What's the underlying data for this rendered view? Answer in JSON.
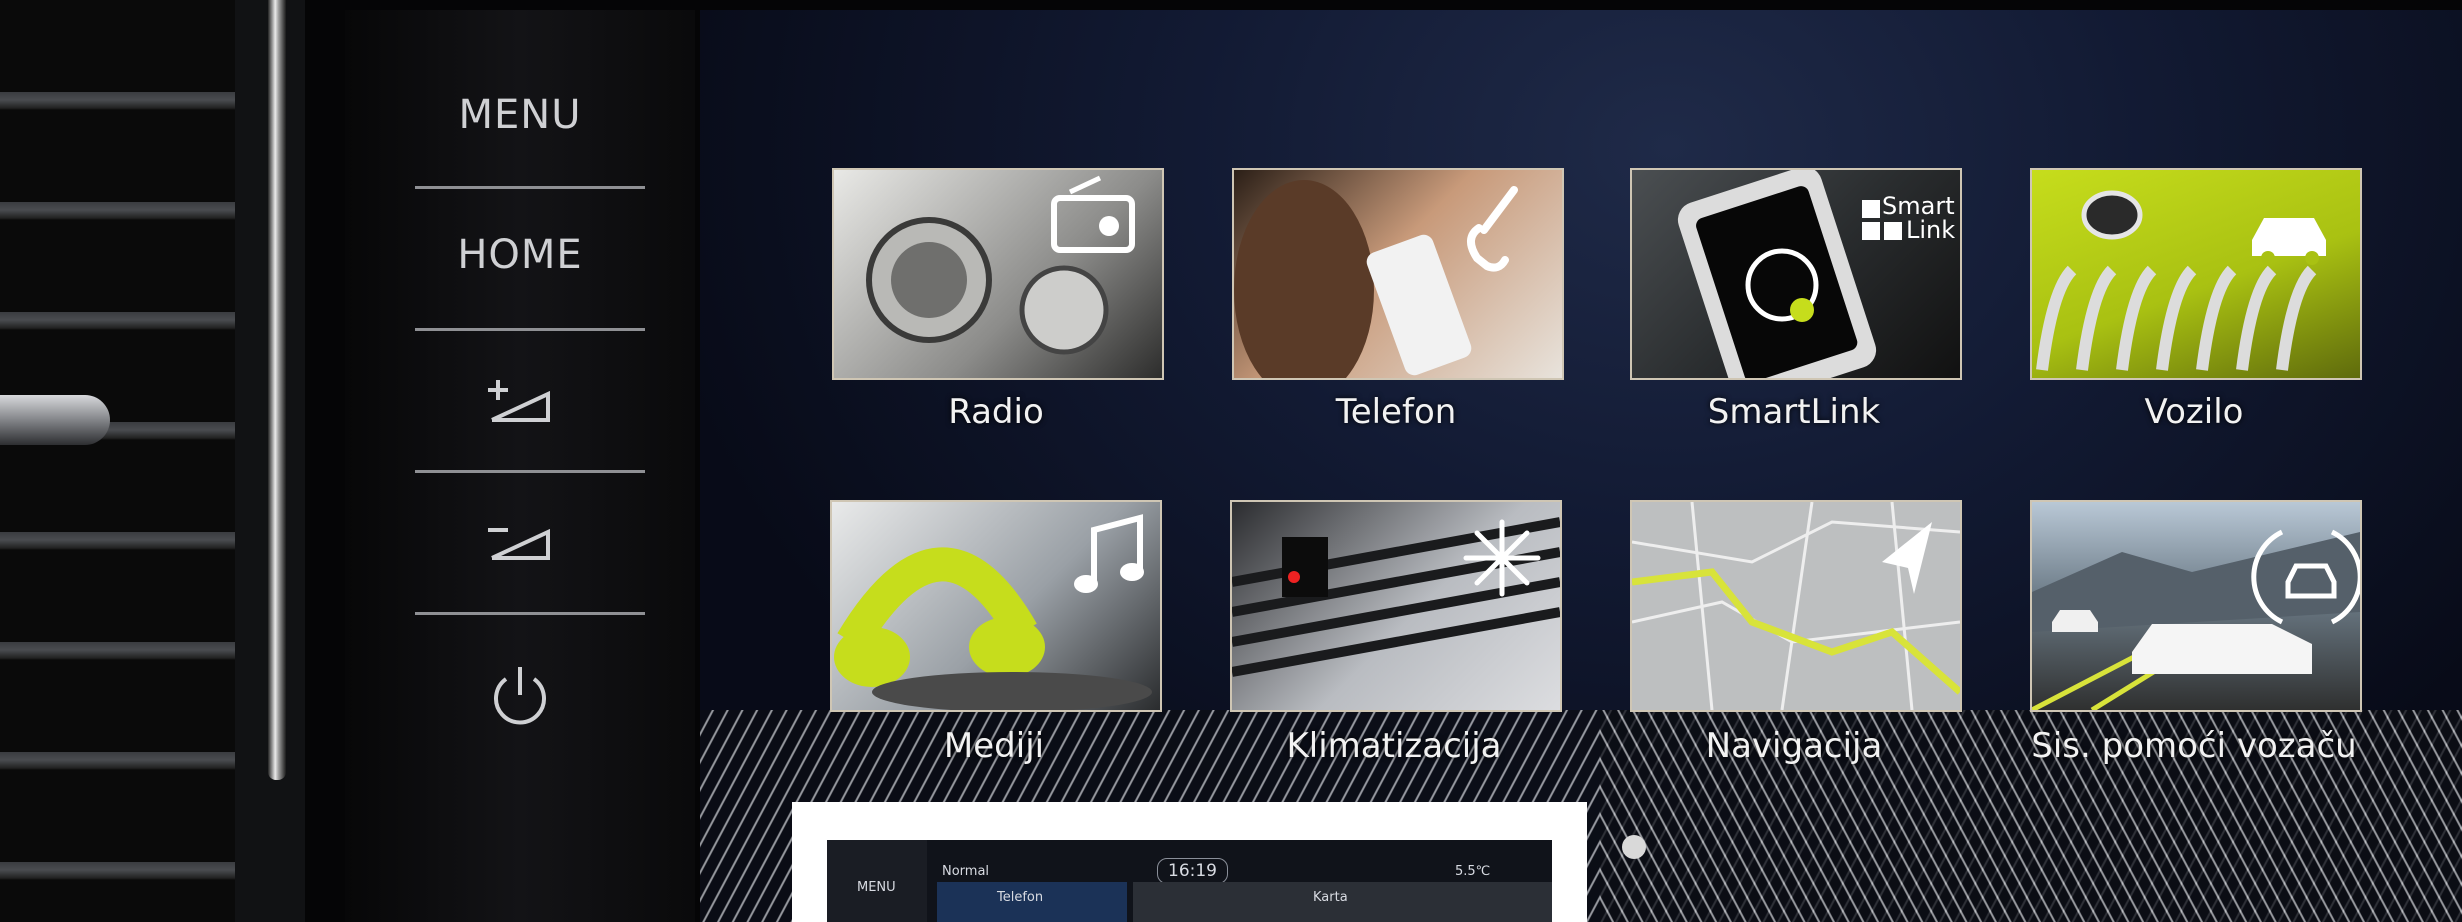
{
  "hardware_buttons": {
    "menu_label": "MENU",
    "home_label": "HOME",
    "volume_up": "volume-up-icon",
    "volume_down": "volume-down-icon",
    "power": "power-icon"
  },
  "tiles": [
    {
      "label": "Radio",
      "icon": "radio-icon"
    },
    {
      "label": "Telefon",
      "icon": "phone-icon"
    },
    {
      "label": "SmartLink",
      "icon": "smartlink-icon",
      "badge_line1": "Smart",
      "badge_line2": "Link"
    },
    {
      "label": "Vozilo",
      "icon": "car-icon"
    },
    {
      "label": "Mediji",
      "icon": "music-note-icon"
    },
    {
      "label": "Klimatizacija",
      "icon": "snowflake-icon"
    },
    {
      "label": "Navigacija",
      "icon": "navigation-arrow-icon"
    },
    {
      "label": "Sis. pomoći vozaču",
      "icon": "driver-assist-icon"
    }
  ],
  "inset": {
    "menu_label": "MENU",
    "mode": "Normal",
    "time": "16:19",
    "temperature": "5.5℃",
    "left_pane_title": "Telefon",
    "right_pane_title": "Karta"
  },
  "colors": {
    "accent_lime": "#c6dd1c",
    "tile_border": "#cfc6b4",
    "screen_background": "#121a33"
  }
}
